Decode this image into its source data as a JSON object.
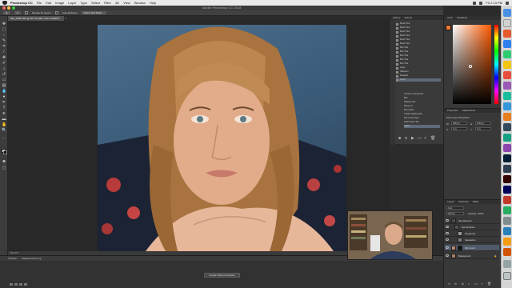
{
  "menubar": {
    "app_name": "Photoshop CC",
    "items": [
      "File",
      "Edit",
      "Image",
      "Layer",
      "Type",
      "Select",
      "Filter",
      "3D",
      "View",
      "Window",
      "Help"
    ],
    "clock": "Fri 2:13 PM"
  },
  "window": {
    "title": "Adobe Photoshop CC 2018"
  },
  "options_bar": {
    "sample_all_layers": "Sample All Layers",
    "auto_enhance": "Auto-Enhance",
    "select_mask": "Select and Mask..."
  },
  "document": {
    "tab_label": "MG_2296.CR2 @ 66.7% (Skin Color, RGB/8*)",
    "zoom_status": "66.67%"
  },
  "history": {
    "tabs": [
      "History",
      "Actions"
    ],
    "items": [
      "Brush Tool",
      "Brush Tool",
      "Brush Tool",
      "Brush Tool",
      "Brush Tool",
      "Brush Tool",
      "Blur Tool",
      "Blur Tool",
      "Blur Tool",
      "Blur Tool",
      "Blur Tool",
      "Layer",
      "Selection",
      "Deselect",
      "Invert"
    ]
  },
  "actions": {
    "items": [
      "Convert to Smart Ob...",
      "Blur",
      "Sharpen Mo...",
      "Merge Vi...",
      "Run Action",
      "Create Clipping Ma...",
      "Set current layer",
      "Select layer \"Ba...",
      "Select"
    ]
  },
  "color_panel": {
    "tabs": [
      "Color",
      "Swatches"
    ],
    "fg_color": "#f27a2b"
  },
  "properties": {
    "tabs": [
      "Properties",
      "Adjustments"
    ],
    "title": "Pixel Layer Properties",
    "w_label": "W:",
    "w_value": "3840 px",
    "h_label": "H:",
    "h_value": "5760 px",
    "x_label": "X:",
    "x_value": "0 px",
    "y_label": "Y:",
    "y_value": "0 px"
  },
  "layers": {
    "tabs": [
      "Layers",
      "Channels",
      "Paths"
    ],
    "kind_label": "Kind",
    "blend_mode": "Normal",
    "opacity": "Opacity: 100%",
    "rows": [
      "Skin Retouch",
      "Eye Enhance",
      "Frequency",
      "Separation",
      "Skin Color",
      "Background"
    ]
  },
  "timeline": {
    "tabs": [
      "Timeline",
      "Measurement Log"
    ],
    "create_button": "Create Frame Animation"
  }
}
